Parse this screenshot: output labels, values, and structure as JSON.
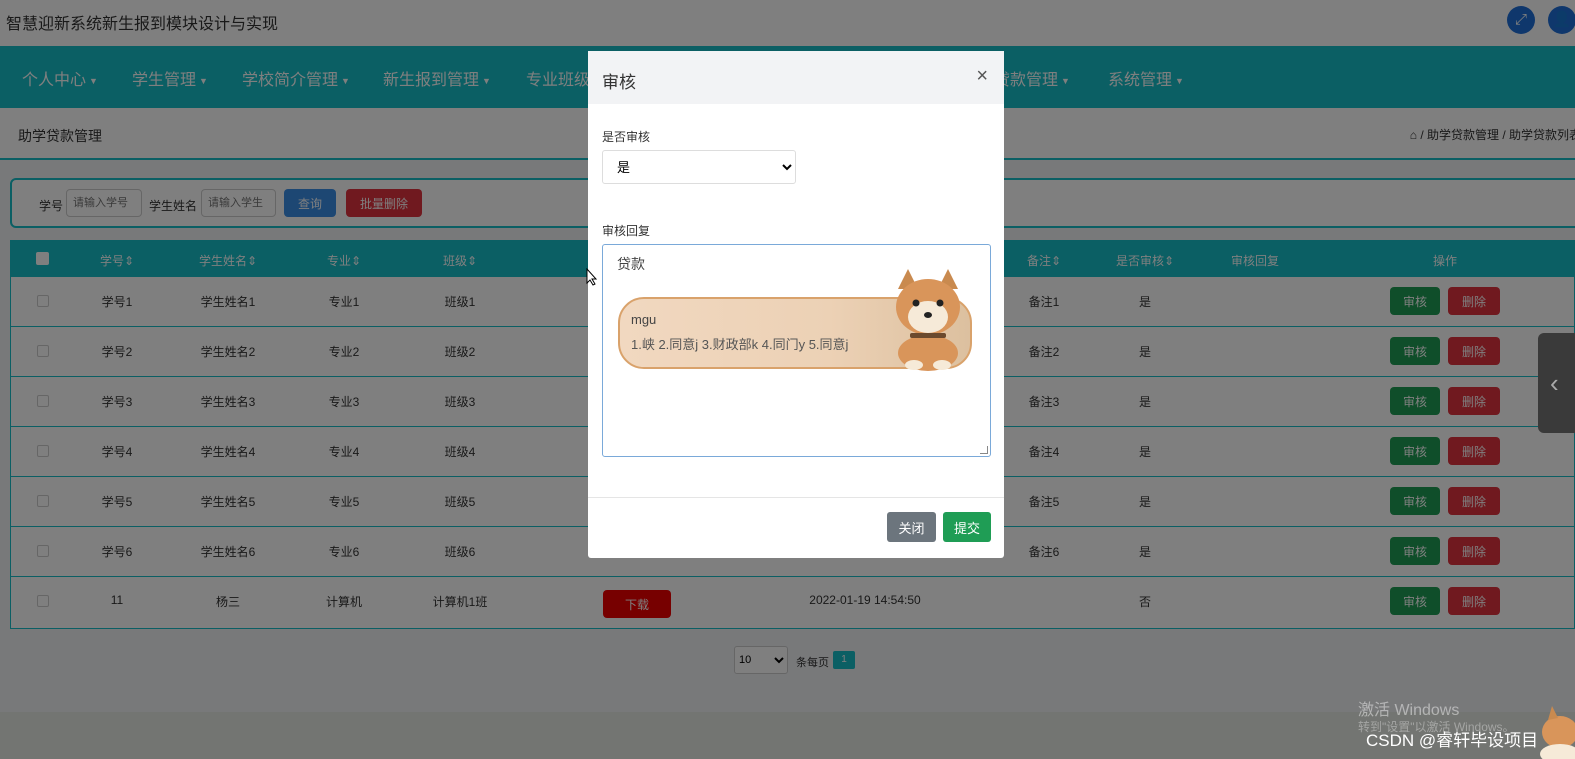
{
  "app": {
    "title": "智慧迎新系统新生报到模块设计与实现"
  },
  "topbar": {
    "fullscreen_icon": "expand-icon",
    "user_icon": "user-icon"
  },
  "nav": {
    "items": [
      {
        "label": "个人中心"
      },
      {
        "label": "学生管理"
      },
      {
        "label": "学校简介管理"
      },
      {
        "label": "新生报到管理"
      },
      {
        "label": "专业班级"
      },
      {
        "label": "贷款管理"
      },
      {
        "label": "系统管理"
      }
    ]
  },
  "breadcrumb": {
    "title": "助学贷款管理",
    "path": "/ 助学贷款管理 / 助学贷款列表"
  },
  "search": {
    "student_no_label": "学号",
    "student_no_placeholder": "请输入学号",
    "student_name_label": "学生姓名",
    "student_name_placeholder": "请输入学生",
    "query_label": "查询",
    "batch_delete_label": "批量删除"
  },
  "table": {
    "headers": {
      "student_no": "学号",
      "student_name": "学生姓名",
      "major": "专业",
      "class": "班级",
      "remark": "备注",
      "audited": "是否审核",
      "audit_reply": "审核回复",
      "actions": "操作"
    },
    "audit_label": "审核",
    "delete_label": "删除",
    "download_label": "下载",
    "rows": [
      {
        "no": "学号1",
        "name": "学生姓名1",
        "major": "专业1",
        "class": "班级1",
        "date": "",
        "remark": "备注1",
        "audited": "是"
      },
      {
        "no": "学号2",
        "name": "学生姓名2",
        "major": "专业2",
        "class": "班级2",
        "date": "",
        "remark": "备注2",
        "audited": "是"
      },
      {
        "no": "学号3",
        "name": "学生姓名3",
        "major": "专业3",
        "class": "班级3",
        "date": "",
        "remark": "备注3",
        "audited": "是"
      },
      {
        "no": "学号4",
        "name": "学生姓名4",
        "major": "专业4",
        "class": "班级4",
        "date": "",
        "remark": "备注4",
        "audited": "是"
      },
      {
        "no": "学号5",
        "name": "学生姓名5",
        "major": "专业5",
        "class": "班级5",
        "date": "",
        "remark": "备注5",
        "audited": "是"
      },
      {
        "no": "学号6",
        "name": "学生姓名6",
        "major": "专业6",
        "class": "班级6",
        "date": "",
        "remark": "备注6",
        "audited": "是"
      },
      {
        "no": "11",
        "name": "杨三",
        "major": "计算机",
        "class": "计算机1班",
        "date": "2022-01-19 14:54:50",
        "remark": "",
        "audited": "否"
      }
    ]
  },
  "pagination": {
    "page_size": "10",
    "per_page_label": "条每页",
    "current_page": "1"
  },
  "modal": {
    "title": "审核",
    "close_icon": "×",
    "audit_label": "是否审核",
    "audit_value": "是",
    "reply_label": "审核回复",
    "reply_value": "贷款",
    "close_button": "关闭",
    "submit_button": "提交"
  },
  "ime": {
    "input": "mgu",
    "candidates": "1.峡  2.同意j  3.财政部k  4.同门y  5.同意j"
  },
  "overlay_text": {
    "activate_windows": "激活 Windows",
    "activate_hint": "转到\"设置\"以激活 Windows。",
    "csdn": "CSDN @睿轩毕设项目"
  },
  "colors": {
    "primary": "#17bec8",
    "success": "#1f9d55",
    "danger": "#e0333f",
    "info": "#3a8ee6"
  }
}
